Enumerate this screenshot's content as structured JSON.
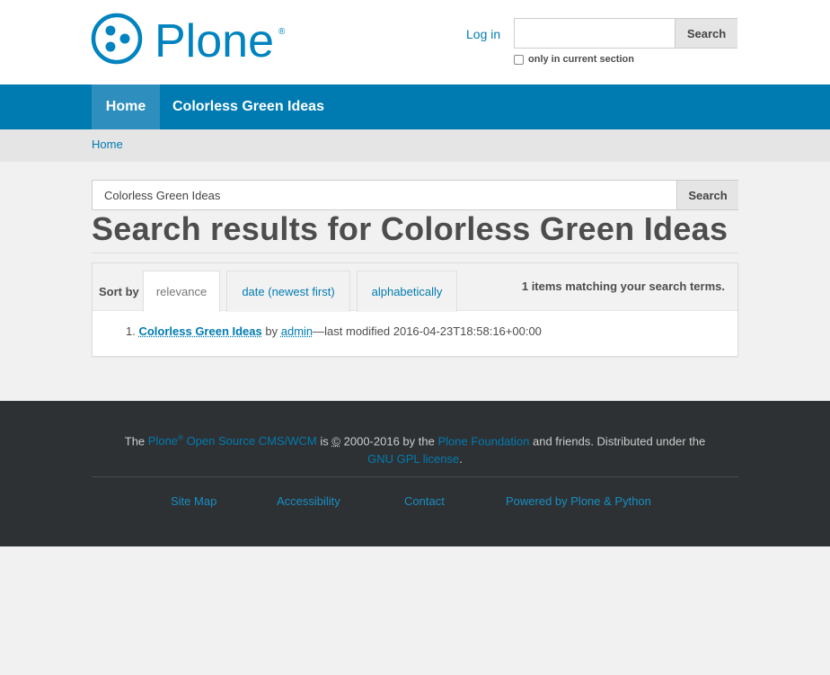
{
  "header": {
    "logo_text": "Plone",
    "login": "Log in",
    "search_value": "",
    "search_button": "Search",
    "section_only": "only in current section"
  },
  "nav": {
    "items": [
      {
        "label": "Home",
        "active": true
      },
      {
        "label": "Colorless Green Ideas",
        "active": false
      }
    ]
  },
  "breadcrumb": {
    "home": "Home"
  },
  "main": {
    "search_value": "Colorless Green Ideas",
    "search_button": "Search",
    "heading_prefix": "Search results for",
    "heading_term": "Colorless Green Ideas",
    "sort": {
      "label": "Sort by",
      "options": [
        "relevance",
        "date (newest first)",
        "alphabetically"
      ],
      "selected": "relevance"
    },
    "count_number": "1",
    "count_text": "items matching your search terms.",
    "results": [
      {
        "index": "1.",
        "title": "Colorless Green Ideas",
        "by": "by",
        "author": "admin",
        "modified": "—last modified 2016-04-23T18:58:16+00:00"
      }
    ]
  },
  "footer": {
    "the": "The",
    "plone": "Plone",
    "reg": "®",
    "cms": "Open Source CMS/WCM",
    "is": "is",
    "copyright_symbol": "©",
    "years": "2000-2016 by the",
    "foundation": "Plone Foundation",
    "friends": "and friends. Distributed under the",
    "license": "GNU GPL license",
    "period": ".",
    "links": {
      "sitemap": "Site Map",
      "accessibility": "Accessibility",
      "contact": "Contact",
      "powered": "Powered by Plone & Python"
    }
  },
  "colors": {
    "brand": "#007bb1",
    "nav_active": "#2e8fbf",
    "footer_bg": "#2e3133"
  }
}
